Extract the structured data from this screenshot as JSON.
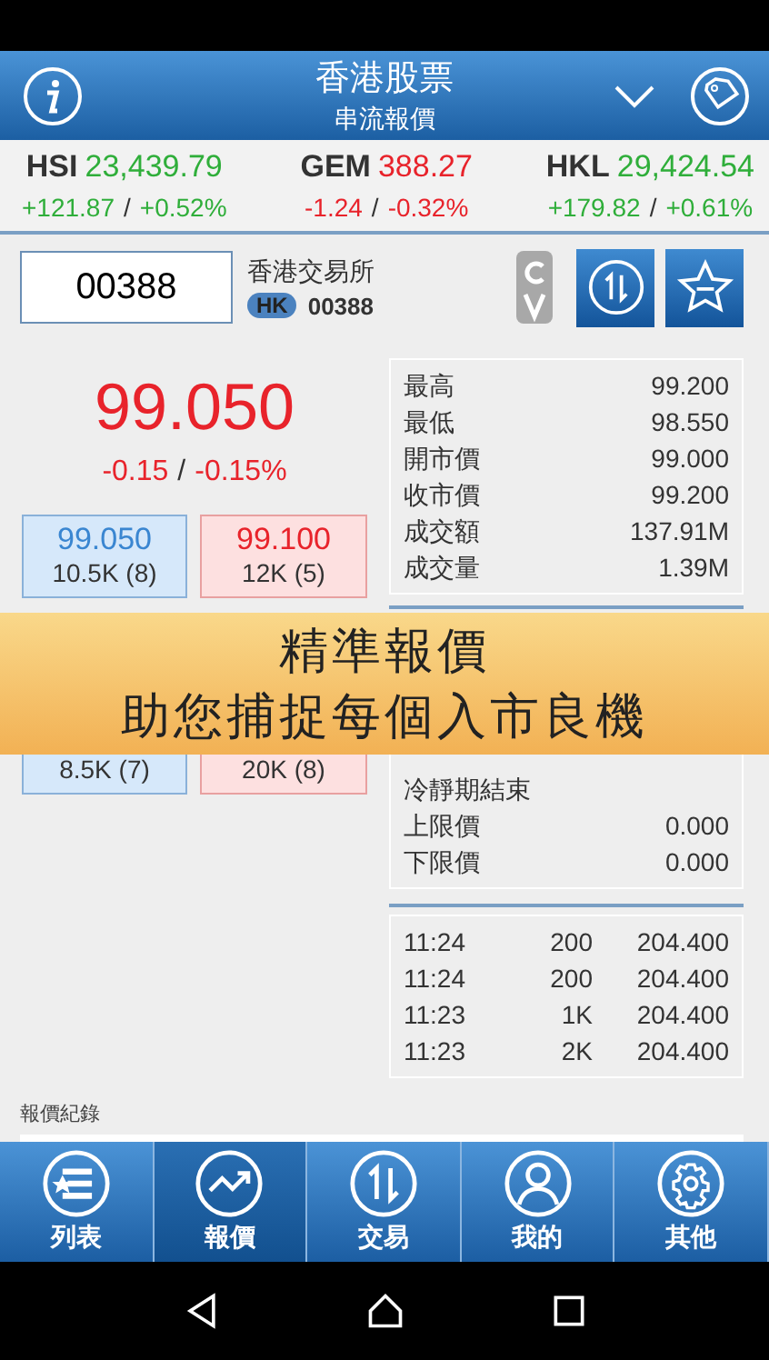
{
  "header": {
    "title": "香港股票",
    "subtitle": "串流報價"
  },
  "indices": [
    {
      "name": "HSI",
      "value": "23,439.79",
      "change": "+121.87",
      "separator": "/",
      "pct": "+0.52%",
      "up": true
    },
    {
      "name": "GEM",
      "value": "388.27",
      "change": "-1.24",
      "separator": "/",
      "pct": "-0.32%",
      "up": false
    },
    {
      "name": "HKL",
      "value": "29,424.54",
      "change": "+179.82",
      "separator": "/",
      "pct": "+0.61%",
      "up": true
    }
  ],
  "stock": {
    "code_input": "00388",
    "name": "香港交易所",
    "market": "HK",
    "code": "00388",
    "price": "99.050",
    "change": "-0.15",
    "separator": "/",
    "pct": "-0.15%",
    "up": false
  },
  "bids": [
    {
      "price": "99.050",
      "volume": "10.5K (8)"
    },
    {
      "volume": "8.5K (7)"
    }
  ],
  "asks": [
    {
      "price": "99.100",
      "volume": "12K (5)"
    },
    {
      "volume": "20K (8)"
    }
  ],
  "stats": [
    {
      "label": "最高",
      "value": "99.200"
    },
    {
      "label": "最低",
      "value": "98.550"
    },
    {
      "label": "開市價",
      "value": "99.000"
    },
    {
      "label": "收市價",
      "value": "99.200"
    },
    {
      "label": "成交額",
      "value": "137.91M"
    },
    {
      "label": "成交量",
      "value": "1.39M"
    }
  ],
  "vcm": [
    {
      "label": "冷靜期結束"
    },
    {
      "label": "上限價",
      "value": "0.000"
    },
    {
      "label": "下限價",
      "value": "0.000"
    }
  ],
  "trades": [
    {
      "time": "11:24",
      "volume": "200",
      "price": "204.400"
    },
    {
      "time": "11:24",
      "volume": "200",
      "price": "204.400"
    },
    {
      "time": "11:23",
      "volume": "1K",
      "price": "204.400"
    },
    {
      "time": "11:23",
      "volume": "2K",
      "price": "204.400"
    }
  ],
  "history_label": "報價紀錄",
  "banner": {
    "line1": "精準報價",
    "line2": "助您捕捉每個入市良機"
  },
  "tabs": [
    {
      "label": "列表",
      "kind": "list",
      "selected": false
    },
    {
      "label": "報價",
      "kind": "chart",
      "selected": true
    },
    {
      "label": "交易",
      "kind": "trade",
      "selected": false
    },
    {
      "label": "我的",
      "kind": "user",
      "selected": false
    },
    {
      "label": "其他",
      "kind": "gear",
      "selected": false
    }
  ]
}
